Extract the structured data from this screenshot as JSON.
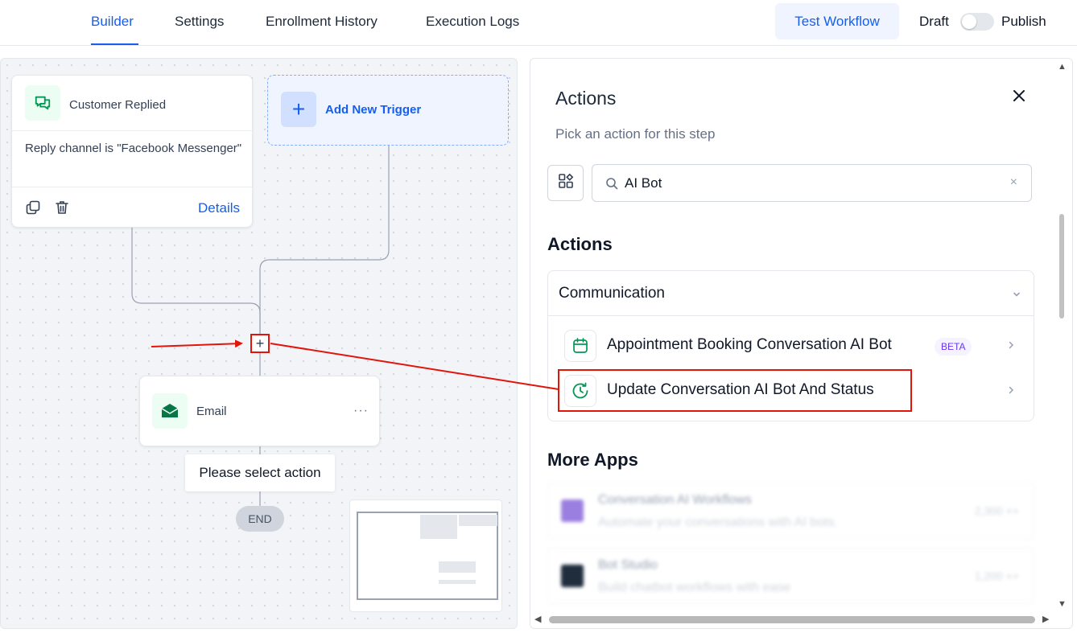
{
  "nav": {
    "tabs": [
      {
        "label": "Builder",
        "active": true
      },
      {
        "label": "Settings",
        "active": false
      },
      {
        "label": "Enrollment History",
        "active": false
      },
      {
        "label": "Execution Logs",
        "active": false
      }
    ],
    "test_button": "Test Workflow",
    "draft_label": "Draft",
    "publish_label": "Publish",
    "publish_toggle_on": false
  },
  "canvas": {
    "trigger": {
      "title": "Customer Replied",
      "condition": "Reply channel is \"Facebook Messenger\"",
      "details_link": "Details"
    },
    "add_trigger": {
      "label": "Add New Trigger",
      "plus": "+"
    },
    "add_step_plus": "+",
    "action_node": {
      "title": "Email",
      "more": "···"
    },
    "tooltip": "Please select action",
    "end_label": "END"
  },
  "panel": {
    "title": "Actions",
    "subtitle": "Pick an action for this step",
    "search": {
      "value": "AI Bot",
      "clear": "×"
    },
    "actions_heading": "Actions",
    "group": {
      "label": "Communication",
      "items": [
        {
          "label": "Appointment Booking Conversation AI Bot",
          "badge": "BETA",
          "icon": "calendar-icon"
        },
        {
          "label": "Update Conversation AI Bot And Status",
          "badge": "",
          "icon": "clock-refresh-icon"
        }
      ]
    },
    "more_apps_heading": "More Apps",
    "apps": [
      {
        "name": "Conversation AI Workflows",
        "desc": "Automate your conversations with AI bots.",
        "meta": "2,300 ++",
        "icon_color": "#9b7fe0"
      },
      {
        "name": "Bot Studio",
        "desc": "Build chatbot workflows with ease",
        "meta": "1,200 ++",
        "icon_color": "#1f2d3d"
      }
    ]
  },
  "colors": {
    "accent": "#155eef",
    "annotation_red": "#e3140a",
    "success_green": "#039855"
  }
}
